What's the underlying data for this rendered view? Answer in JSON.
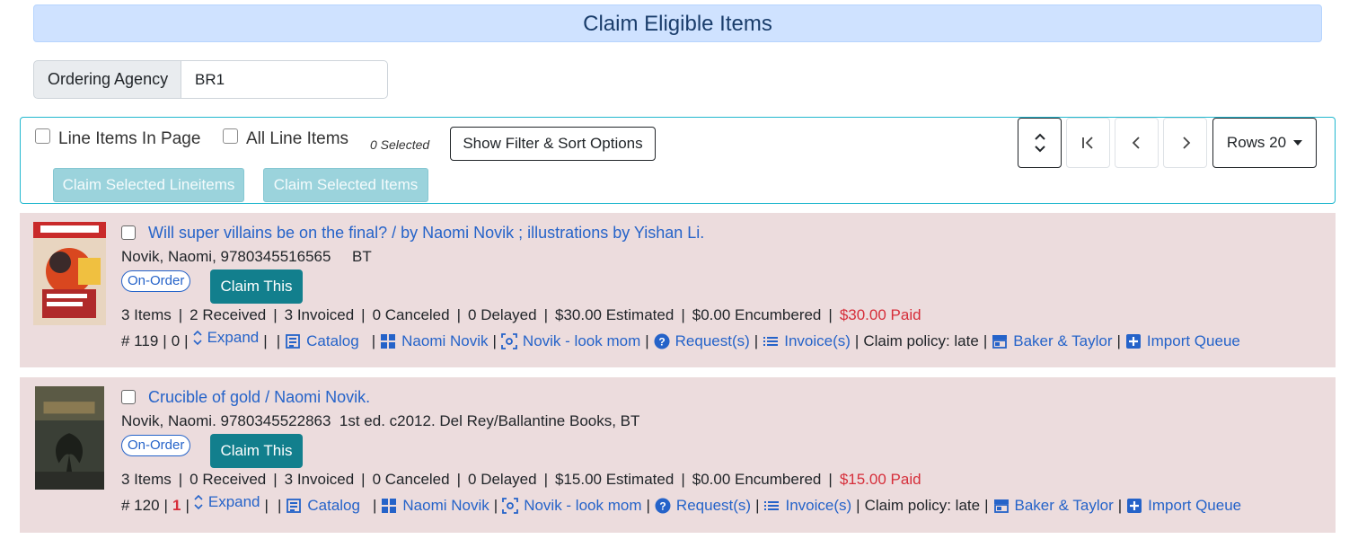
{
  "header": {
    "title": "Claim Eligible Items"
  },
  "agency": {
    "label": "Ordering Agency",
    "value": "BR1"
  },
  "toolbar": {
    "line_items_in_page": "Line Items In Page",
    "all_line_items": "All Line Items",
    "selected_count": "0 Selected",
    "filter_sort_label": "Show Filter & Sort Options",
    "claim_selected_lineitems": "Claim Selected Lineitems",
    "claim_selected_items": "Claim Selected Items",
    "rows_label": "Rows 20"
  },
  "items": [
    {
      "title": "Will super villains be on the final? / by Naomi Novik ; illustrations by Yishan Li.",
      "author_line": "Novik, Naomi, 9780345516565     BT",
      "status": "On-Order",
      "claim_label": "Claim This",
      "stats": {
        "items": "3 Items",
        "received": "2 Received",
        "invoiced": "3 Invoiced",
        "canceled": "0 Canceled",
        "delayed": "0 Delayed",
        "estimated": "$30.00 Estimated",
        "encumbered": "$0.00 Encumbered",
        "paid": "$30.00 Paid"
      },
      "number": "# 119",
      "count": "0",
      "links": {
        "expand": "Expand",
        "catalog": "Catalog",
        "author": "Naomi Novik",
        "search": "Novik - look mom",
        "requests": "Request(s)",
        "invoices": "Invoice(s)",
        "claim_policy": "Claim policy: late",
        "vendor": "Baker & Taylor",
        "import_queue": "Import Queue"
      }
    },
    {
      "title": "Crucible of gold / Naomi Novik.",
      "author_line": "Novik, Naomi. 9780345522863  1st ed. c2012. Del Rey/Ballantine Books, BT",
      "status": "On-Order",
      "claim_label": "Claim This",
      "stats": {
        "items": "3 Items",
        "received": "0 Received",
        "invoiced": "3 Invoiced",
        "canceled": "0 Canceled",
        "delayed": "0 Delayed",
        "estimated": "$15.00 Estimated",
        "encumbered": "$0.00 Encumbered",
        "paid": "$15.00 Paid"
      },
      "number": "# 120",
      "count": "1",
      "links": {
        "expand": "Expand",
        "catalog": "Catalog",
        "author": "Naomi Novik",
        "search": "Novik - look mom",
        "requests": "Request(s)",
        "invoices": "Invoice(s)",
        "claim_policy": "Claim policy: late",
        "vendor": "Baker & Taylor",
        "import_queue": "Import Queue"
      }
    }
  ],
  "colors": {
    "accent": "#127f8d",
    "link": "#2563c9",
    "paid": "#d62e3a",
    "row_bg": "#ecdcdd"
  }
}
